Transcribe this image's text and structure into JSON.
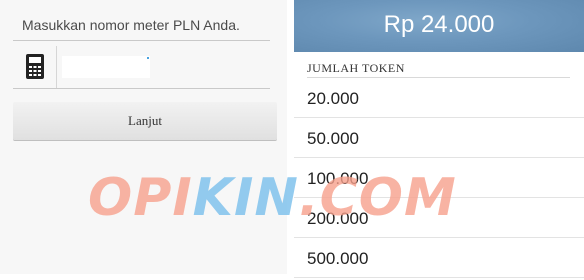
{
  "form": {
    "prompt": "Masukkan nomor meter PLN Anda.",
    "meter_input_value": "",
    "meter_input_placeholder": "",
    "meter_icon": "meter-icon",
    "next_label": "Lanjut"
  },
  "price_panel": {
    "amount": "Rp 24.000",
    "section_label": "JUMLAH TOKEN",
    "tokens": [
      "20.000",
      "50.000",
      "100.000",
      "200.000",
      "500.000"
    ]
  },
  "watermark": {
    "part1": "OPI",
    "part2": "KIN",
    "part3": ".COM"
  },
  "colors": {
    "header_blue": "#6d97bd",
    "watermark_salmon": "#f6a08c",
    "watermark_blue": "#78bee b"
  }
}
